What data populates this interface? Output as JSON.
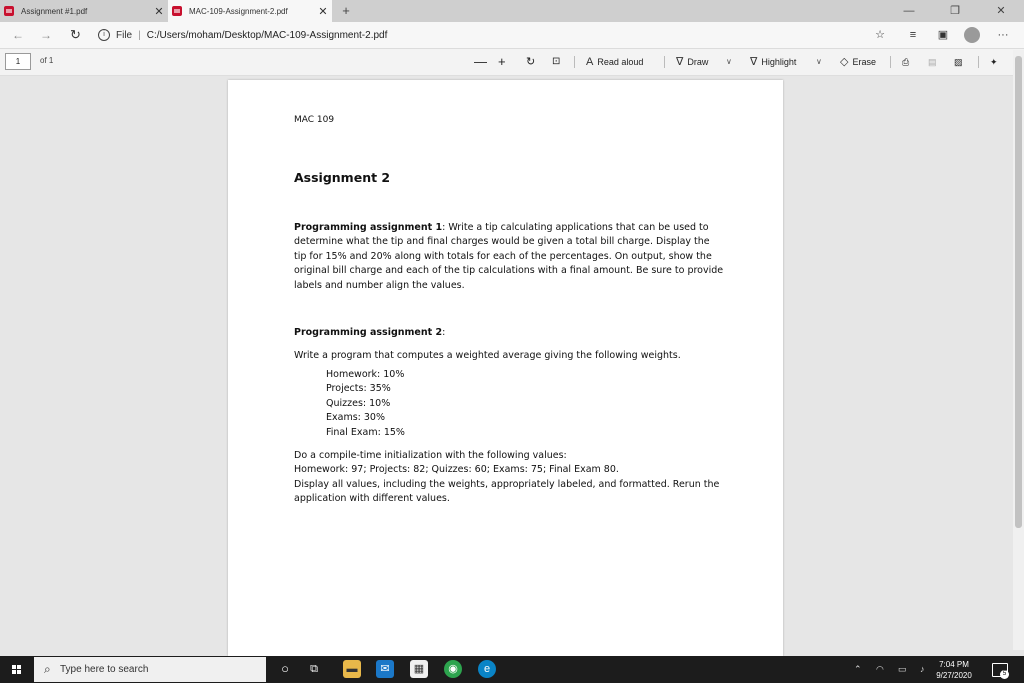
{
  "tabs": [
    {
      "title": "Assignment #1.pdf",
      "active": false
    },
    {
      "title": "MAC-109-Assignment-2.pdf",
      "active": true
    }
  ],
  "address": {
    "scheme_label": "File",
    "url": "C:/Users/moham/Desktop/MAC-109-Assignment-2.pdf"
  },
  "pdf_toolbar": {
    "page_current": "1",
    "page_of": "of 1",
    "read_aloud": "Read aloud",
    "draw": "Draw",
    "highlight": "Highlight",
    "erase": "Erase"
  },
  "document": {
    "course": "MAC 109",
    "title": "Assignment 2",
    "assignment1_label": "Programming assignment 1",
    "assignment1_text": ": Write a tip calculating applications that can be used to determine what the tip and final charges would be given a total bill charge. Display the tip for 15% and 20% along with totals for each of the percentages. On output, show the original bill charge and each of the tip calculations with a final amount. Be sure to provide labels and number align the values.",
    "assignment2_label": "Programming assignment 2",
    "assignment2_colon": ":",
    "assignment2_intro": "Write a program that computes a weighted average giving the following weights.",
    "weights": [
      "Homework: 10%",
      "Projects: 35%",
      "Quizzes: 10%",
      "Exams: 30%",
      "Final Exam: 15%"
    ],
    "init_line1": "Do a compile-time initialization with the following values:",
    "init_line2": "Homework: 97; Projects: 82; Quizzes: 60; Exams: 75; Final Exam 80.",
    "init_line3": "Display all values, including the weights, appropriately labeled, and formatted. Rerun the application with different values."
  },
  "taskbar": {
    "search_placeholder": "Type here to search",
    "time": "7:04 PM",
    "date": "9/27/2020",
    "notification_count": "5"
  },
  "colors": {
    "pdf_red": "#c8102e",
    "taskbar": "#1c1c1c",
    "edge_blue": "#0a84c6",
    "chrome_green": "#2da44e"
  }
}
